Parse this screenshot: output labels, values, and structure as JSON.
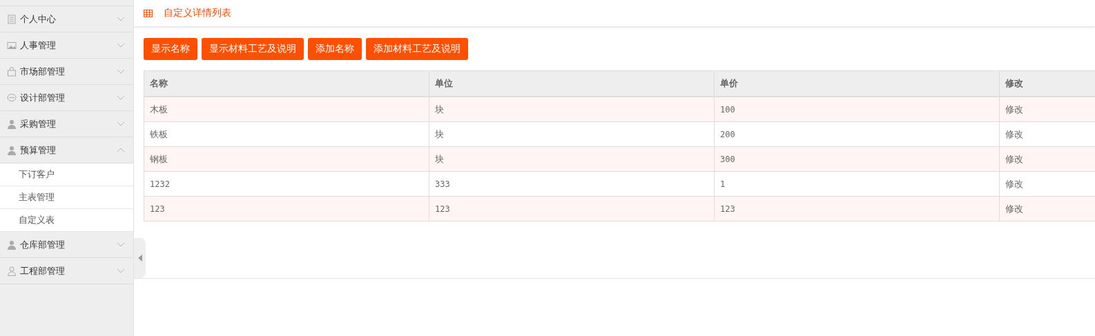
{
  "sidebar": {
    "items": [
      {
        "label": "个人中心",
        "kind": "doc",
        "expanded": false
      },
      {
        "label": "人事管理",
        "kind": "image",
        "expanded": false
      },
      {
        "label": "市场部管理",
        "kind": "bag",
        "expanded": false
      },
      {
        "label": "设计部管理",
        "kind": "chat",
        "expanded": false
      },
      {
        "label": "采购管理",
        "kind": "person",
        "expanded": false
      },
      {
        "label": "预算管理",
        "kind": "person",
        "expanded": true,
        "children": [
          {
            "label": "下订客户"
          },
          {
            "label": "主表管理"
          },
          {
            "label": "自定义表"
          }
        ]
      },
      {
        "label": "仓库部管理",
        "kind": "person",
        "expanded": false
      },
      {
        "label": "工程部管理",
        "kind": "person-outline",
        "expanded": false
      }
    ]
  },
  "header": {
    "title": "自定义详情列表"
  },
  "buttons": [
    "显示名称",
    "显示材料工艺及说明",
    "添加名称",
    "添加材料工艺及说明"
  ],
  "table": {
    "columns": [
      "名称",
      "单位",
      "单价",
      "修改"
    ],
    "rows": [
      [
        "木板",
        "块",
        "100",
        "修改"
      ],
      [
        "铁板",
        "块",
        "200",
        "修改"
      ],
      [
        "钢板",
        "块",
        "300",
        "修改"
      ],
      [
        "1232",
        "333",
        "1",
        "修改"
      ],
      [
        "123",
        "123",
        "123",
        "修改"
      ]
    ]
  }
}
